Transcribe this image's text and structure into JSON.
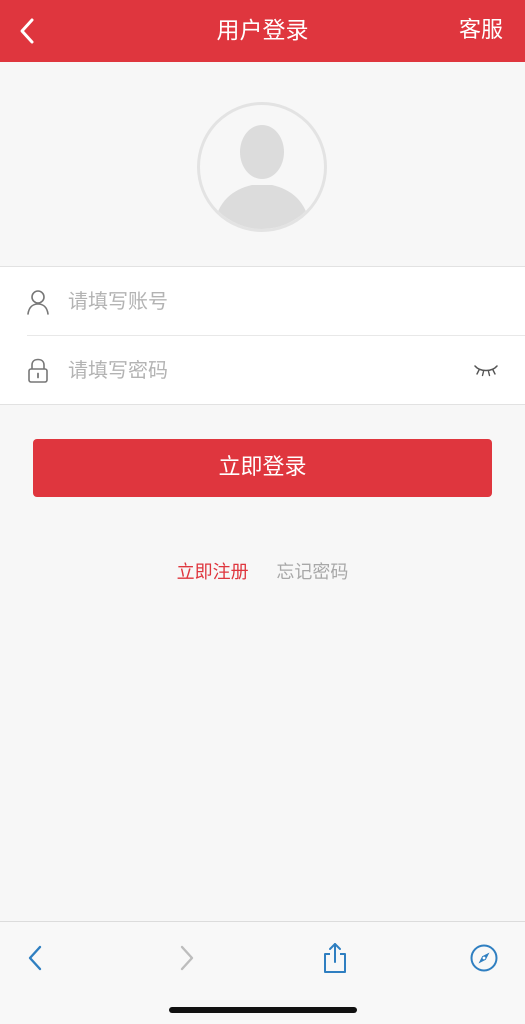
{
  "header": {
    "title": "用户登录",
    "service_label": "客服",
    "back_icon": "chevron-left-icon",
    "background_color": "#df363e"
  },
  "avatar": {
    "icon": "default-user-avatar-icon"
  },
  "form": {
    "account": {
      "icon": "user-outline-icon",
      "placeholder": "请填写账号",
      "value": ""
    },
    "password": {
      "icon": "lock-icon",
      "placeholder": "请填写密码",
      "value": "",
      "toggle_icon": "eye-closed-icon"
    }
  },
  "login_button": {
    "label": "立即登录",
    "color": "#df363e"
  },
  "links": {
    "register": "立即注册",
    "forgot_password": "忘记密码"
  },
  "browser_toolbar": {
    "items": [
      "back-arrow-icon",
      "forward-arrow-icon",
      "share-icon",
      "compass-icon"
    ],
    "accent_color": "#2f7fc1"
  }
}
